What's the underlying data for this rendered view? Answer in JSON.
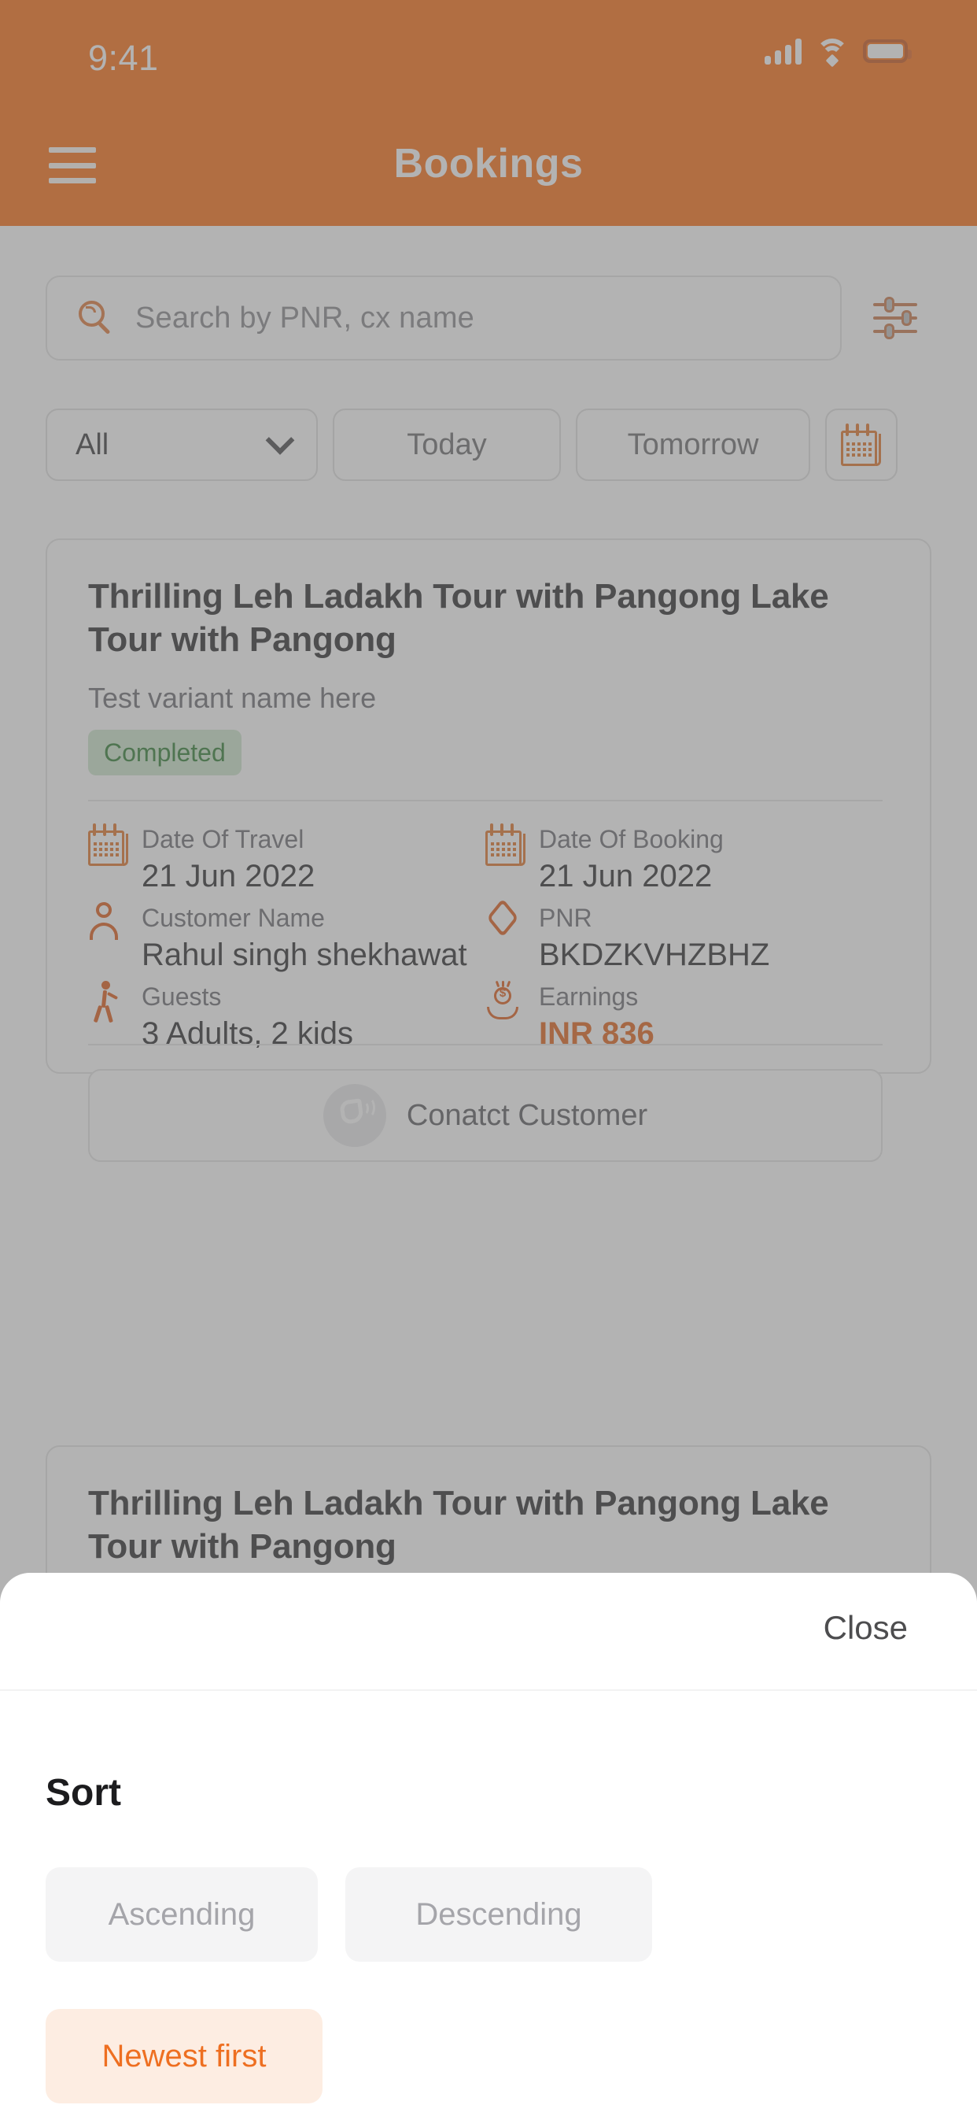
{
  "status_bar": {
    "time": "9:41",
    "signal_icon": "cellular-signal-icon",
    "wifi_icon": "wifi-icon",
    "battery_icon": "battery-icon"
  },
  "header": {
    "title": "Bookings",
    "menu_icon": "hamburger-menu-icon",
    "background_color": "#FA7014"
  },
  "search": {
    "placeholder": "Search by PNR, cx name",
    "value": "",
    "search_icon": "search-icon",
    "filter_icon": "filter-sliders-icon"
  },
  "filters": {
    "dropdown_label": "All",
    "chips": [
      {
        "label": "Today",
        "name": "filter-chip-today"
      },
      {
        "label": "Tomorrow",
        "name": "filter-chip-tomorrow"
      }
    ],
    "calendar_icon": "calendar-icon"
  },
  "bookings": [
    {
      "title": "Thrilling Leh Ladakh Tour with Pangong Lake Tour with Pangong",
      "variant": "Test variant name here",
      "status": "Completed",
      "status_color": "#2E7D32",
      "status_background": "#CDE5CC",
      "fields": [
        {
          "label": "Date Of Travel",
          "value": "21 Jun 2022",
          "icon": "calendar-icon"
        },
        {
          "label": "Date Of Booking",
          "value": "21 Jun 2022",
          "icon": "calendar-icon"
        },
        {
          "label": "Customer Name",
          "value": "Rahul singh shekhawat",
          "icon": "person-icon"
        },
        {
          "label": "PNR",
          "value": "BKDZKVHZBHZ",
          "icon": "tag-icon"
        },
        {
          "label": "Guests",
          "value": "3 Adults, 2 kids",
          "icon": "guest-walking-icon"
        },
        {
          "label": "Earnings",
          "value": "INR 836",
          "icon": "earnings-hand-coin-icon",
          "accent": true
        }
      ],
      "contact_button": "Conatct Customer",
      "contact_icon": "phone-call-icon"
    },
    {
      "title": "Thrilling Leh Ladakh Tour with Pangong Lake Tour with Pangong"
    }
  ],
  "sheet": {
    "close_label": "Close",
    "section_title": "Sort",
    "options": [
      {
        "label": "Ascending",
        "selected": false
      },
      {
        "label": "Descending",
        "selected": false
      },
      {
        "label": "Newest first",
        "selected": true
      }
    ]
  },
  "colors": {
    "brand_orange": "#FA7014",
    "accent_orange": "#E2631B",
    "selected_chip_bg": "#FDEDE2",
    "selected_chip_text": "#EE6F21"
  }
}
